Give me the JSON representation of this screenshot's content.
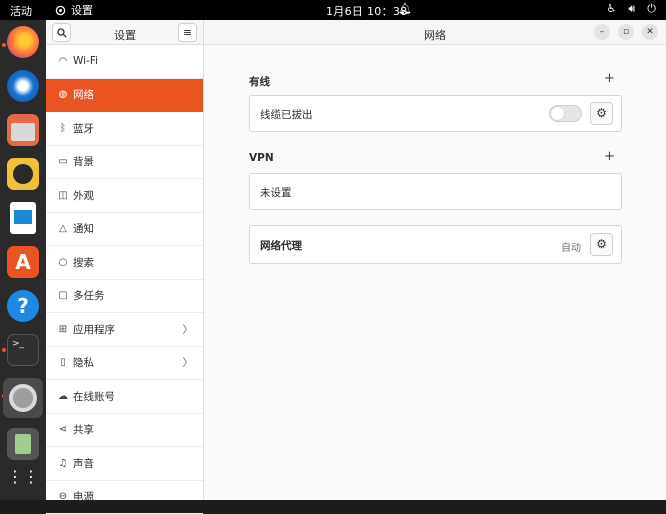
{
  "topbar": {
    "activities": "活动",
    "app_name": "设置",
    "clock": "1月6日  10：38",
    "bell_icon": "bell-icon",
    "tray_icons": [
      "accessibility-icon",
      "volume-icon",
      "power-icon"
    ]
  },
  "dock": {
    "apps": [
      "firefox",
      "thunderbird",
      "files",
      "rhythmbox",
      "writer",
      "app-center",
      "help",
      "terminal",
      "settings",
      "trash",
      "show-apps"
    ]
  },
  "sidebar": {
    "title": "设置",
    "items": [
      {
        "label": "Wi-Fi",
        "icon": "wifi-icon"
      },
      {
        "label": "网络",
        "icon": "network-icon",
        "selected": true
      },
      {
        "label": "蓝牙",
        "icon": "bluetooth-icon"
      },
      {
        "label": "背景",
        "icon": "background-icon"
      },
      {
        "label": "外观",
        "icon": "appearance-icon"
      },
      {
        "label": "通知",
        "icon": "bell-icon"
      },
      {
        "label": "搜索",
        "icon": "search-icon"
      },
      {
        "label": "多任务",
        "icon": "multitask-icon"
      },
      {
        "label": "应用程序",
        "icon": "apps-icon",
        "chevron": true
      },
      {
        "label": "隐私",
        "icon": "privacy-icon",
        "chevron": true
      },
      {
        "label": "在线账号",
        "icon": "cloud-icon"
      },
      {
        "label": "共享",
        "icon": "share-icon"
      },
      {
        "label": "声音",
        "icon": "music-icon"
      },
      {
        "label": "电源",
        "icon": "power-icon"
      }
    ]
  },
  "main": {
    "title": "网络",
    "wired": {
      "heading": "有线",
      "row_label": "线缆已拔出"
    },
    "vpn": {
      "heading": "VPN",
      "row_label": "未设置"
    },
    "proxy": {
      "label": "网络代理",
      "status": "自动"
    }
  },
  "colors": {
    "accent": "#e95420",
    "topbar": "#000000",
    "dock": "#2a2a2a"
  }
}
